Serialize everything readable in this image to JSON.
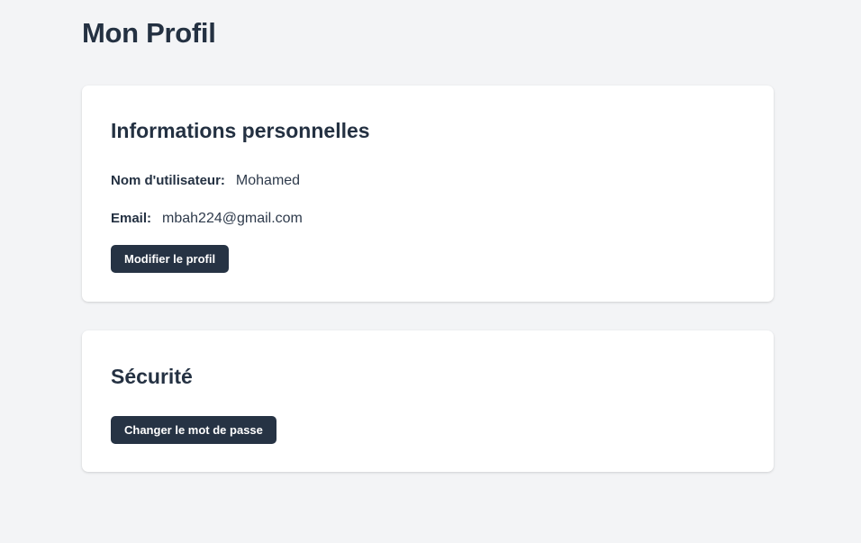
{
  "page": {
    "title": "Mon Profil"
  },
  "personal_info": {
    "title": "Informations personnelles",
    "username_label": "Nom d'utilisateur:",
    "username_value": "Mohamed",
    "email_label": "Email:",
    "email_value": "mbah224@gmail.com",
    "edit_button": "Modifier le profil"
  },
  "security": {
    "title": "Sécurité",
    "change_password_button": "Changer le mot de passe"
  },
  "colors": {
    "background": "#f3f4f6",
    "card": "#ffffff",
    "text": "#243142",
    "button": "#263344",
    "button_text": "#ffffff"
  }
}
